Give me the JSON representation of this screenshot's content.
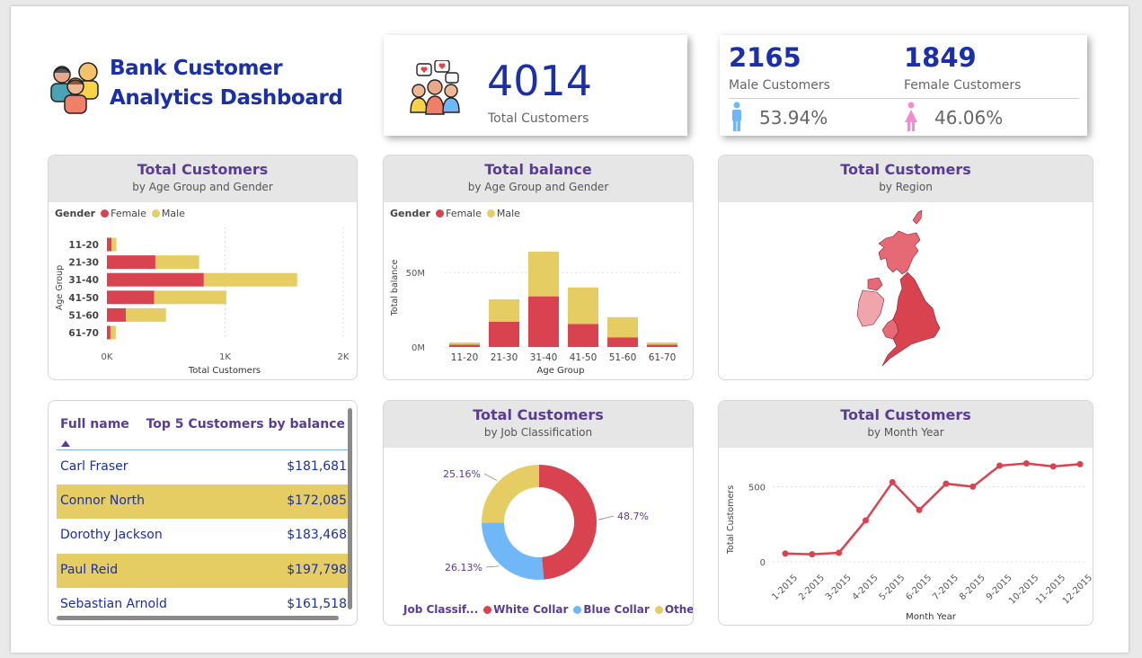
{
  "header": {
    "title_line1": "Bank Customer",
    "title_line2": "Analytics Dashboard",
    "icon": "customers-group-icon"
  },
  "kpi_total": {
    "value": "4014",
    "label": "Total Customers",
    "icon": "people-chat-icon"
  },
  "kpi_gender": {
    "male_value": "2165",
    "male_label": "Male Customers",
    "male_pct": "53.94%",
    "female_value": "1849",
    "female_label": "Female Customers",
    "female_pct": "46.06%",
    "male_icon": "male-person-icon",
    "female_icon": "female-person-icon"
  },
  "colors": {
    "female": "#d9434f",
    "male": "#e6cd63",
    "white_collar": "#d9434f",
    "blue_collar": "#6fb7f7",
    "other": "#e6cd63",
    "title": "#5b3c95",
    "brand": "#1a2fa8"
  },
  "panels": {
    "age_gender": {
      "title": "Total Customers",
      "subtitle": "by Age Group and Gender"
    },
    "balance": {
      "title": "Total balance",
      "subtitle": "by Age Group and Gender"
    },
    "region": {
      "title": "Total Customers",
      "subtitle": "by Region"
    },
    "job": {
      "title": "Total Customers",
      "subtitle": "by Job Classification"
    },
    "month": {
      "title": "Total Customers",
      "subtitle": "by Month Year"
    }
  },
  "legend": {
    "gender_label": "Gender",
    "female": "Female",
    "male": "Male",
    "job_label": "Job Classif...",
    "white_collar": "White Collar",
    "blue_collar": "Blue Collar",
    "other": "Other"
  },
  "table": {
    "col_name": "Full name",
    "col_balance": "Top 5 Customers by balance",
    "rows": [
      {
        "name": "Carl Fraser",
        "balance": "$181,681"
      },
      {
        "name": "Connor North",
        "balance": "$172,085"
      },
      {
        "name": "Dorothy Jackson",
        "balance": "$183,468"
      },
      {
        "name": "Paul Reid",
        "balance": "$197,798"
      },
      {
        "name": "Sebastian Arnold",
        "balance": "$161,518"
      }
    ]
  },
  "chart_data": [
    {
      "type": "bar",
      "orientation": "horizontal",
      "stacked": true,
      "title": "Total Customers",
      "subtitle": "by Age Group and Gender",
      "categories": [
        "11-20",
        "21-30",
        "31-40",
        "41-50",
        "51-60",
        "61-70"
      ],
      "series": [
        {
          "name": "Female",
          "values": [
            40,
            410,
            820,
            400,
            160,
            30
          ]
        },
        {
          "name": "Male",
          "values": [
            40,
            370,
            790,
            610,
            340,
            45
          ]
        }
      ],
      "xlabel": "Total Customers",
      "ylabel": "Age Group",
      "xlim": [
        0,
        2000
      ],
      "xticks": [
        "0K",
        "1K",
        "2K"
      ],
      "legend_title": "Gender",
      "legend": "top-left",
      "grid": true
    },
    {
      "type": "bar",
      "stacked": true,
      "title": "Total balance",
      "subtitle": "by Age Group and Gender",
      "categories": [
        "11-20",
        "21-30",
        "31-40",
        "41-50",
        "51-60",
        "61-70"
      ],
      "series": [
        {
          "name": "Female",
          "values": [
            1500000,
            17000000,
            34000000,
            15500000,
            6500000,
            1500000
          ]
        },
        {
          "name": "Male",
          "values": [
            1500000,
            15000000,
            30000000,
            24500000,
            13500000,
            1500000
          ]
        }
      ],
      "xlabel": "Age Group",
      "ylabel": "Total balance",
      "ylim": [
        0,
        70000000
      ],
      "yticks": [
        "0M",
        "50M"
      ],
      "legend_title": "Gender",
      "legend": "top-left",
      "grid": true
    },
    {
      "type": "pie",
      "donut": true,
      "title": "Total Customers",
      "subtitle": "by Job Classification",
      "labels": [
        "White Collar",
        "Blue Collar",
        "Other"
      ],
      "values": [
        48.7,
        26.13,
        25.16
      ],
      "value_labels": [
        "48.7%",
        "26.13%",
        "25.16%"
      ],
      "legend_title": "Job Classif...",
      "legend": "bottom"
    },
    {
      "type": "line",
      "title": "Total Customers",
      "subtitle": "by Month Year",
      "x": [
        "1-2015",
        "2-2015",
        "3-2015",
        "4-2015",
        "5-2015",
        "6-2015",
        "7-2015",
        "8-2015",
        "9-2015",
        "10-2015",
        "11-2015",
        "12-2015"
      ],
      "series": [
        {
          "values": [
            55,
            50,
            60,
            275,
            530,
            345,
            520,
            500,
            640,
            655,
            635,
            650
          ]
        }
      ],
      "xlabel": "Month Year",
      "ylabel": "Total Customers",
      "ylim": [
        0,
        700
      ],
      "yticks": [
        "0",
        "500"
      ],
      "grid": true
    }
  ]
}
